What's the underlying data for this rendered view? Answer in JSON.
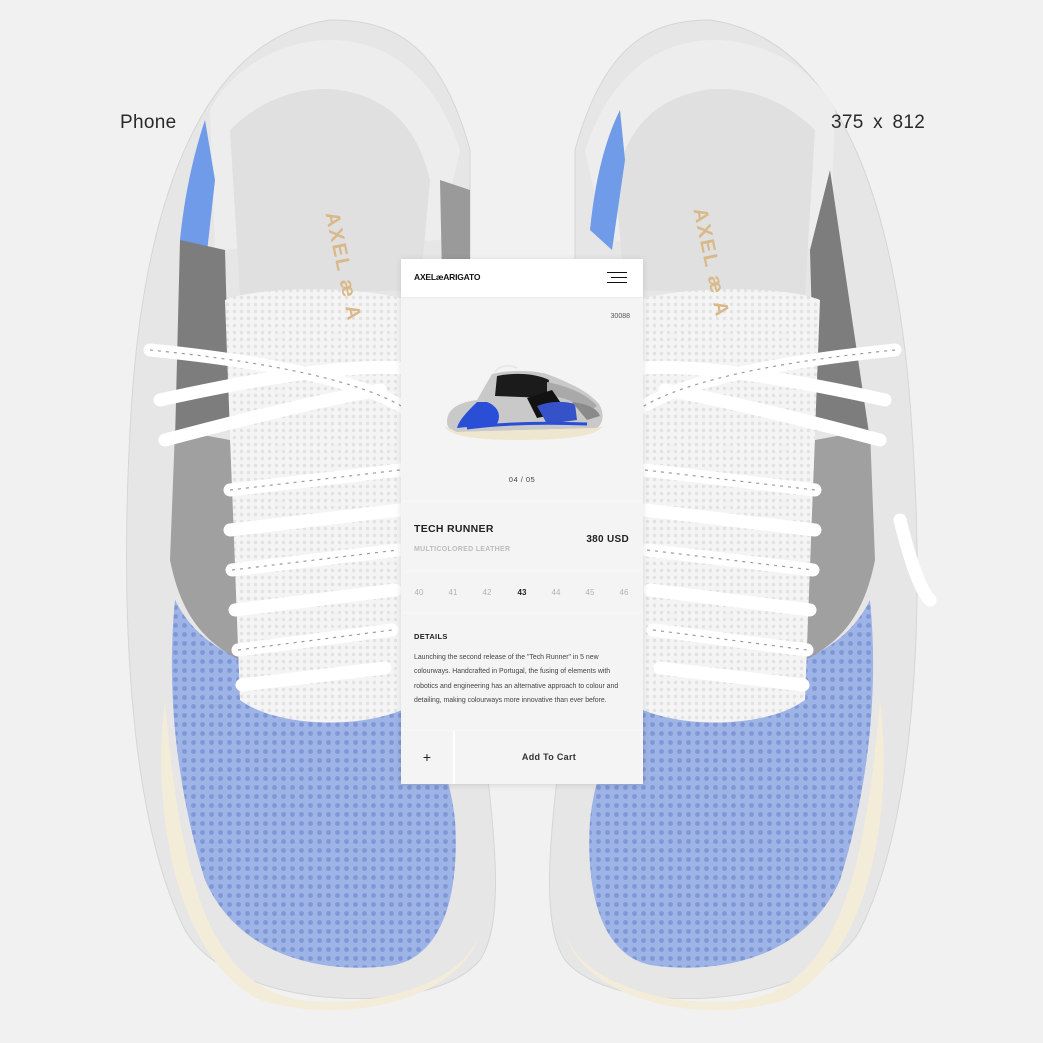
{
  "canvas": {
    "phone_label": "Phone",
    "dimensions_label": "375 x  812",
    "brand_mark_left": "AXEL æ A",
    "brand_mark_right": "AXEL æ A"
  },
  "app": {
    "logo": "AXELæARIGATO",
    "menu_icon": "hamburger-menu-icon"
  },
  "product": {
    "sku": "30088",
    "image_counter": "04 / 05",
    "name": "TECH RUNNER",
    "material": "MULTICOLORED LEATHER",
    "price": "380 USD"
  },
  "sizes": {
    "options": [
      "40",
      "41",
      "42",
      "43",
      "44",
      "45",
      "46"
    ],
    "selected": "43"
  },
  "details": {
    "title": "DETAILS",
    "body": "Launching the second release of the \"Tech Runner\" in 5 new colourways. Handcrafted in Portugal, the fusing of elements with robotics and engineering has an alternative approach to colour and detailing, making colourways more innovative than ever before."
  },
  "actions": {
    "plus_label": "+",
    "add_to_cart_label": "Add To Cart"
  },
  "colors": {
    "background": "#f1f1f1",
    "accent_blue": "#2a4fd6",
    "text_dark": "#222222",
    "text_muted": "#b3b3b3"
  }
}
